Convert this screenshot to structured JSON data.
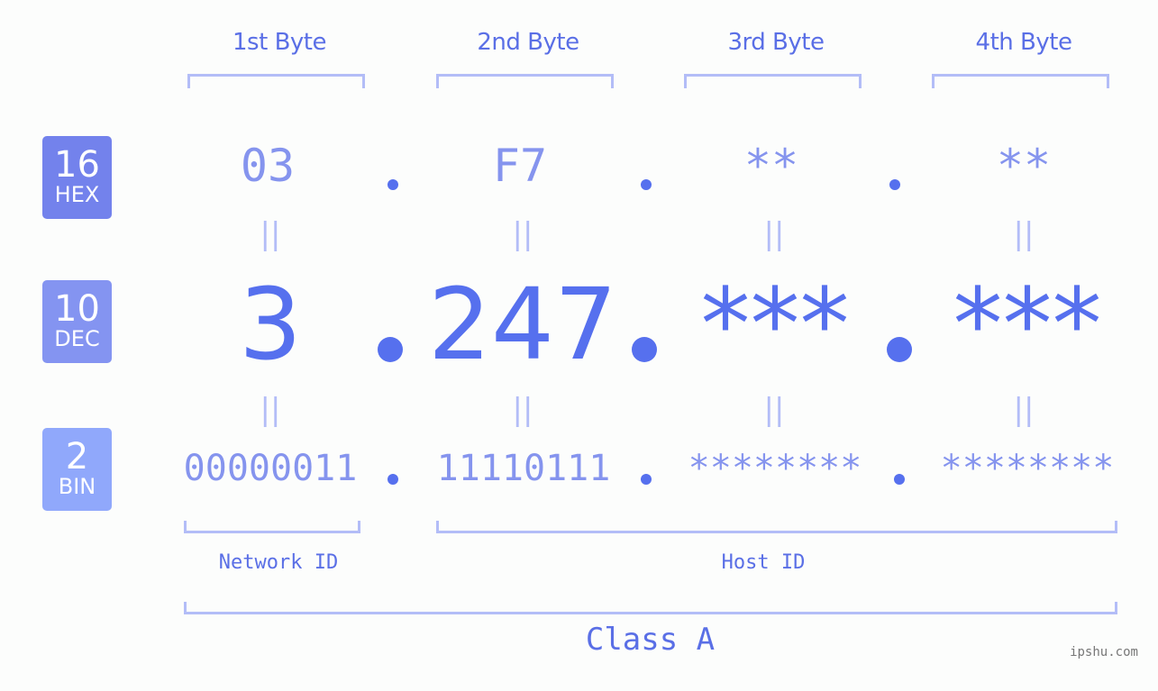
{
  "bytes": [
    {
      "header": "1st Byte",
      "hex": "03",
      "dec": "3",
      "bin": "00000011"
    },
    {
      "header": "2nd Byte",
      "hex": "F7",
      "dec": "247",
      "bin": "11110111"
    },
    {
      "header": "3rd Byte",
      "hex": "**",
      "dec": "***",
      "bin": "********"
    },
    {
      "header": "4th Byte",
      "hex": "**",
      "dec": "***",
      "bin": "********"
    }
  ],
  "badges": {
    "hex": {
      "num": "16",
      "label": "HEX",
      "color": "#7382ec"
    },
    "dec": {
      "num": "10",
      "label": "DEC",
      "color": "#8494f1"
    },
    "bin": {
      "num": "2",
      "label": "BIN",
      "color": "#90a8fb"
    }
  },
  "equals_symbol": "||",
  "network_id_label": "Network ID",
  "host_id_label": "Host ID",
  "class_label": "Class A",
  "watermark": "ipshu.com",
  "colors": {
    "primary": "#5670ee",
    "secondary": "#8594ee",
    "bracket": "#b3bdf7"
  }
}
